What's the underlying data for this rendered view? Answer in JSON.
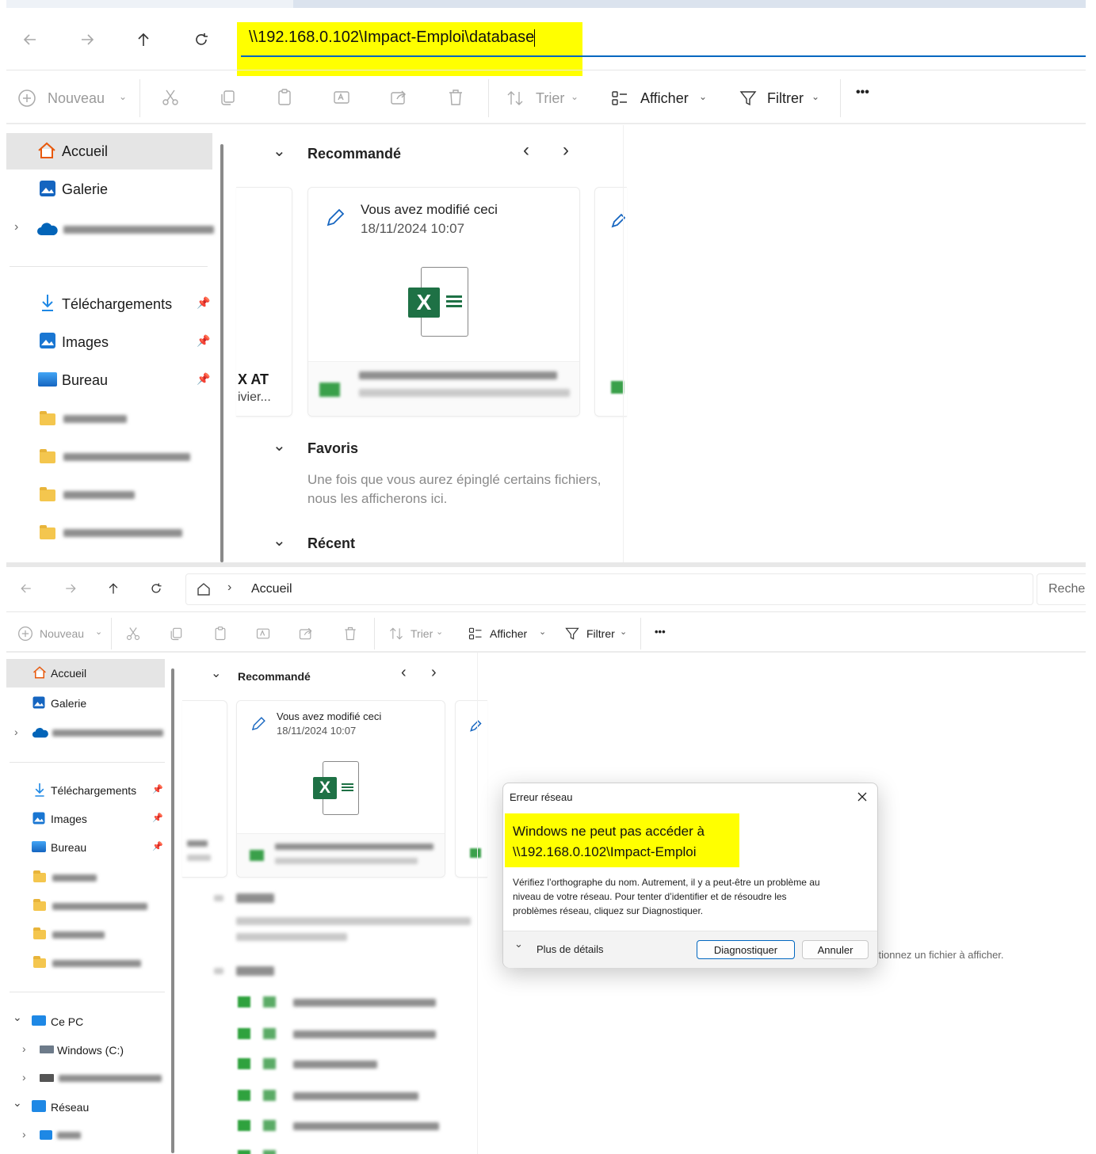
{
  "top": {
    "address": "\\\\192.168.0.102\\Impact-Emploi\\database",
    "toolbar": {
      "new": "Nouveau",
      "sort": "Trier",
      "view": "Afficher",
      "filter": "Filtrer",
      "more": "•••"
    },
    "sidebar": {
      "home": "Accueil",
      "gallery": "Galerie",
      "downloads": "Téléchargements",
      "images": "Images",
      "desktop": "Bureau"
    },
    "recommended": "Recommandé",
    "card": {
      "title": "Vous avez modifié ceci",
      "date": "18/11/2024 10:07"
    },
    "partial_card": {
      "line1": "X AT",
      "line2": "ivier..."
    },
    "favorites": "Favoris",
    "favorites_empty_1": "Une fois que vous aurez épinglé certains fichiers,",
    "favorites_empty_2": "nous les afficherons ici.",
    "recent": "Récent"
  },
  "bottom": {
    "breadcrumb": "Accueil",
    "search": "Recher",
    "toolbar": {
      "new": "Nouveau",
      "sort": "Trier",
      "view": "Afficher",
      "filter": "Filtrer",
      "more": "•••"
    },
    "sidebar": {
      "home": "Accueil",
      "gallery": "Galerie",
      "downloads": "Téléchargements",
      "images": "Images",
      "desktop": "Bureau",
      "this_pc": "Ce PC",
      "windows_c": "Windows (C:)",
      "network": "Réseau"
    },
    "recommended": "Recommandé",
    "card": {
      "title": "Vous avez modifié ceci",
      "date": "18/11/2024 10:07"
    },
    "details_hint": "ctionnez un fichier à afficher."
  },
  "dialog": {
    "title": "Erreur réseau",
    "headline_1": "Windows ne peut pas accéder à",
    "headline_2": "\\\\192.168.0.102\\Impact-Emploi",
    "body_1": "Vérifiez l’orthographe du nom. Autrement, il y a peut-être un problème au",
    "body_2": "niveau de votre réseau. Pour tenter d’identifier et de résoudre les",
    "body_3": "problèmes réseau, cliquez sur Diagnostiquer.",
    "more_details": "Plus de détails",
    "diagnose": "Diagnostiquer",
    "cancel": "Annuler"
  },
  "colors": {
    "highlight": "#ffff00",
    "accent": "#0067c0",
    "excel": "#1e7145"
  }
}
